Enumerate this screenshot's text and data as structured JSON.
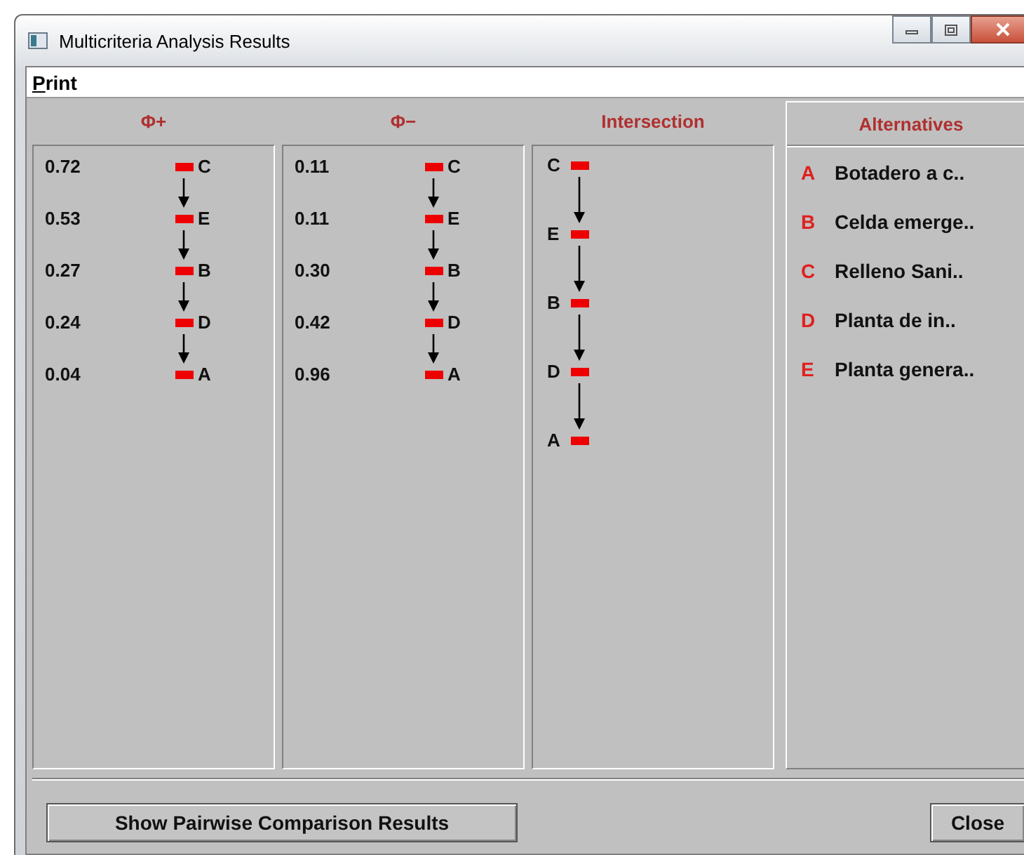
{
  "window": {
    "title": "Multicriteria Analysis Results"
  },
  "menu": [
    {
      "label": "Print"
    }
  ],
  "phi_plus": {
    "title": "Φ+",
    "rows": [
      {
        "value": "0.72",
        "label": "C"
      },
      {
        "value": "0.53",
        "label": "E"
      },
      {
        "value": "0.27",
        "label": "B"
      },
      {
        "value": "0.24",
        "label": "D"
      },
      {
        "value": "0.04",
        "label": "A"
      }
    ]
  },
  "phi_minus": {
    "title": "Φ−",
    "rows": [
      {
        "value": "0.11",
        "label": "C"
      },
      {
        "value": "0.11",
        "label": "E"
      },
      {
        "value": "0.30",
        "label": "B"
      },
      {
        "value": "0.42",
        "label": "D"
      },
      {
        "value": "0.96",
        "label": "A"
      }
    ]
  },
  "intersection": {
    "title": "Intersection",
    "nodes": [
      "C",
      "E",
      "B",
      "D",
      "A"
    ]
  },
  "alternatives": {
    "title": "Alternatives",
    "items": [
      {
        "letter": "A",
        "name": "Botadero a c.."
      },
      {
        "letter": "B",
        "name": "Celda emerge.."
      },
      {
        "letter": "C",
        "name": "Relleno Sani.."
      },
      {
        "letter": "D",
        "name": "Planta de in.."
      },
      {
        "letter": "E",
        "name": "Planta genera.."
      }
    ]
  },
  "buttons": [
    {
      "label": "Show Pairwise Comparison Results",
      "kind": "wide"
    },
    {
      "label": "Close",
      "kind": "small"
    }
  ]
}
